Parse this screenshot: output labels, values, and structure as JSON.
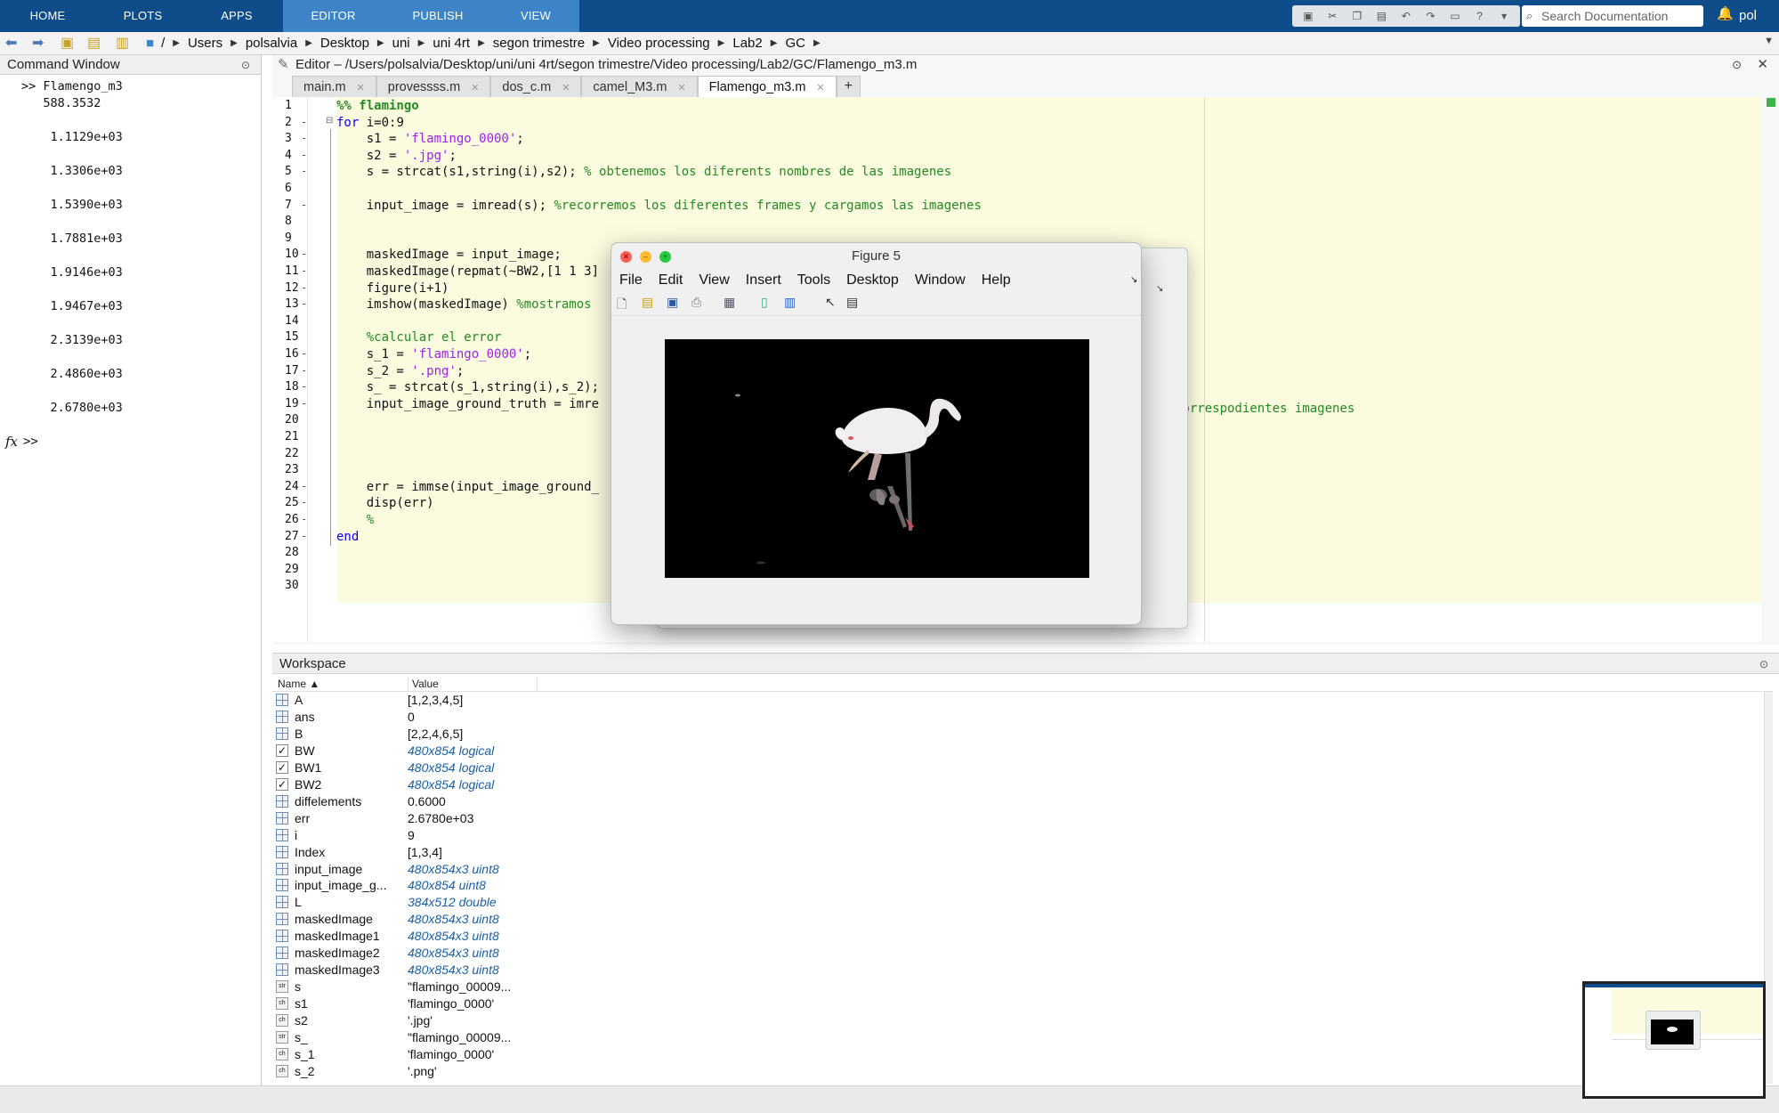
{
  "ribbon": {
    "tabs": [
      {
        "label": "HOME",
        "active": false
      },
      {
        "label": "PLOTS",
        "active": false
      },
      {
        "label": "APPS",
        "active": false
      },
      {
        "label": "EDITOR",
        "active": true
      },
      {
        "label": "PUBLISH",
        "active": false
      },
      {
        "label": "VIEW",
        "active": false
      }
    ],
    "search_placeholder": "Search Documentation",
    "user": "pol",
    "colors": {
      "ribbon": "#0f4d8a",
      "active_tab": "#3d85c6"
    }
  },
  "path": {
    "root": "/",
    "crumbs": [
      "Users",
      "polsalvia",
      "Desktop",
      "uni",
      "uni 4rt",
      "segon trimestre",
      "Video processing",
      "Lab2",
      "GC"
    ]
  },
  "command_window": {
    "title": "Command Window",
    "output": [
      ">> Flamengo_m3",
      "   588.3532",
      "",
      "    1.1129e+03",
      "",
      "    1.3306e+03",
      "",
      "    1.5390e+03",
      "",
      "    1.7881e+03",
      "",
      "    1.9146e+03",
      "",
      "    1.9467e+03",
      "",
      "    2.3139e+03",
      "",
      "    2.4860e+03",
      "",
      "    2.6780e+03"
    ],
    "fx": "fx",
    "prompt": ">>"
  },
  "editor": {
    "title": "Editor – /Users/polsalvia/Desktop/uni/uni 4rt/segon trimestre/Video processing/Lab2/GC/Flamengo_m3.m",
    "tabs": [
      {
        "label": "main.m",
        "active": false
      },
      {
        "label": "provessss.m",
        "active": false
      },
      {
        "label": "dos_c.m",
        "active": false
      },
      {
        "label": "camel_M3.m",
        "active": false
      },
      {
        "label": "Flamengo_m3.m",
        "active": true
      }
    ],
    "lines": [
      {
        "n": "1",
        "dash": false,
        "parts": [
          {
            "t": "%% flamingo",
            "c": "cell"
          }
        ]
      },
      {
        "n": "2",
        "dash": true,
        "parts": [
          {
            "t": "for",
            "c": "k"
          },
          {
            "t": " i=0:9",
            "c": ""
          }
        ]
      },
      {
        "n": "3",
        "dash": true,
        "parts": [
          {
            "t": "    s1 = ",
            "c": ""
          },
          {
            "t": "'flamingo_0000'",
            "c": "s"
          },
          {
            "t": ";",
            "c": ""
          }
        ]
      },
      {
        "n": "4",
        "dash": true,
        "parts": [
          {
            "t": "    s2 = ",
            "c": ""
          },
          {
            "t": "'.jpg'",
            "c": "s"
          },
          {
            "t": ";",
            "c": ""
          }
        ]
      },
      {
        "n": "5",
        "dash": true,
        "parts": [
          {
            "t": "    s = strcat(s1,string(i),s2); ",
            "c": ""
          },
          {
            "t": "% obtenemos los diferents nombres de las imagenes",
            "c": "c"
          }
        ]
      },
      {
        "n": "6",
        "dash": false,
        "parts": []
      },
      {
        "n": "7",
        "dash": true,
        "parts": [
          {
            "t": "    input_image = imread(s); ",
            "c": ""
          },
          {
            "t": "%recorremos los diferentes frames y cargamos las imagenes",
            "c": "c"
          }
        ]
      },
      {
        "n": "8",
        "dash": false,
        "parts": []
      },
      {
        "n": "9",
        "dash": false,
        "parts": []
      },
      {
        "n": "10",
        "dash": true,
        "parts": [
          {
            "t": "    maskedImage = input_image;",
            "c": ""
          }
        ]
      },
      {
        "n": "11",
        "dash": true,
        "parts": [
          {
            "t": "    maskedImage(repmat(~BW2,[1 1 3]",
            "c": ""
          }
        ]
      },
      {
        "n": "12",
        "dash": true,
        "parts": [
          {
            "t": "    figure(i+1)",
            "c": ""
          }
        ]
      },
      {
        "n": "13",
        "dash": true,
        "parts": [
          {
            "t": "    imshow(maskedImage) ",
            "c": ""
          },
          {
            "t": "%mostramos",
            "c": "c"
          }
        ]
      },
      {
        "n": "14",
        "dash": false,
        "parts": []
      },
      {
        "n": "15",
        "dash": false,
        "parts": [
          {
            "t": "    %calcular el error",
            "c": "c"
          }
        ]
      },
      {
        "n": "16",
        "dash": true,
        "parts": [
          {
            "t": "    s_1 = ",
            "c": ""
          },
          {
            "t": "'flamingo_0000'",
            "c": "s"
          },
          {
            "t": ";",
            "c": ""
          }
        ]
      },
      {
        "n": "17",
        "dash": true,
        "parts": [
          {
            "t": "    s_2 = ",
            "c": ""
          },
          {
            "t": "'.png'",
            "c": "s"
          },
          {
            "t": ";",
            "c": ""
          }
        ]
      },
      {
        "n": "18",
        "dash": true,
        "parts": [
          {
            "t": "    s_ = strcat(s_1,string(i),s_2);",
            "c": ""
          }
        ]
      },
      {
        "n": "19",
        "dash": true,
        "parts": [
          {
            "t": "    input_image_ground_truth = imre",
            "c": ""
          }
        ]
      },
      {
        "n": "20",
        "dash": false,
        "parts": []
      },
      {
        "n": "21",
        "dash": false,
        "parts": []
      },
      {
        "n": "22",
        "dash": false,
        "parts": []
      },
      {
        "n": "23",
        "dash": false,
        "parts": []
      },
      {
        "n": "24",
        "dash": true,
        "parts": [
          {
            "t": "    err = immse(input_image_ground_",
            "c": ""
          }
        ]
      },
      {
        "n": "25",
        "dash": true,
        "parts": [
          {
            "t": "    disp(err)",
            "c": ""
          }
        ]
      },
      {
        "n": "26",
        "dash": true,
        "parts": [
          {
            "t": "    %",
            "c": "c"
          }
        ]
      },
      {
        "n": "27",
        "dash": true,
        "parts": [
          {
            "t": "end",
            "c": "k"
          }
        ]
      },
      {
        "n": "28",
        "dash": false,
        "parts": []
      },
      {
        "n": "29",
        "dash": false,
        "parts": []
      },
      {
        "n": "30",
        "dash": false,
        "parts": []
      }
    ],
    "line19_tail": "correspodientes imagenes"
  },
  "figure": {
    "title": "Figure 5",
    "menu": [
      "File",
      "Edit",
      "View",
      "Insert",
      "Tools",
      "Desktop",
      "Window",
      "Help"
    ]
  },
  "workspace": {
    "title": "Workspace",
    "col_name": "Name ▲",
    "col_value": "Value",
    "vars": [
      {
        "name": "A",
        "value": "[1,2,3,4,5]",
        "type": "num",
        "italic": false
      },
      {
        "name": "ans",
        "value": "0",
        "type": "num",
        "italic": false
      },
      {
        "name": "B",
        "value": "[2,2,4,6,5]",
        "type": "num",
        "italic": false
      },
      {
        "name": "BW",
        "value": "480x854 logical",
        "type": "logical",
        "italic": true
      },
      {
        "name": "BW1",
        "value": "480x854 logical",
        "type": "logical",
        "italic": true
      },
      {
        "name": "BW2",
        "value": "480x854 logical",
        "type": "logical",
        "italic": true
      },
      {
        "name": "diffelements",
        "value": "0.6000",
        "type": "num",
        "italic": false
      },
      {
        "name": "err",
        "value": "2.6780e+03",
        "type": "num",
        "italic": false
      },
      {
        "name": "i",
        "value": "9",
        "type": "num",
        "italic": false
      },
      {
        "name": "Index",
        "value": "[1,3,4]",
        "type": "num",
        "italic": false
      },
      {
        "name": "input_image",
        "value": "480x854x3 uint8",
        "type": "num",
        "italic": true
      },
      {
        "name": "input_image_g...",
        "value": "480x854 uint8",
        "type": "num",
        "italic": true
      },
      {
        "name": "L",
        "value": "384x512 double",
        "type": "num",
        "italic": true
      },
      {
        "name": "maskedImage",
        "value": "480x854x3 uint8",
        "type": "num",
        "italic": true
      },
      {
        "name": "maskedImage1",
        "value": "480x854x3 uint8",
        "type": "num",
        "italic": true
      },
      {
        "name": "maskedImage2",
        "value": "480x854x3 uint8",
        "type": "num",
        "italic": true
      },
      {
        "name": "maskedImage3",
        "value": "480x854x3 uint8",
        "type": "num",
        "italic": true
      },
      {
        "name": "s",
        "value": "\"flamingo_00009...",
        "type": "str",
        "italic": false
      },
      {
        "name": "s1",
        "value": "'flamingo_0000'",
        "type": "char",
        "italic": false
      },
      {
        "name": "s2",
        "value": "'.jpg'",
        "type": "char",
        "italic": false
      },
      {
        "name": "s_",
        "value": "\"flamingo_00009...",
        "type": "str",
        "italic": false
      },
      {
        "name": "s_1",
        "value": "'flamingo_0000'",
        "type": "char",
        "italic": false
      },
      {
        "name": "s_2",
        "value": "'.png'",
        "type": "char",
        "italic": false
      }
    ]
  }
}
